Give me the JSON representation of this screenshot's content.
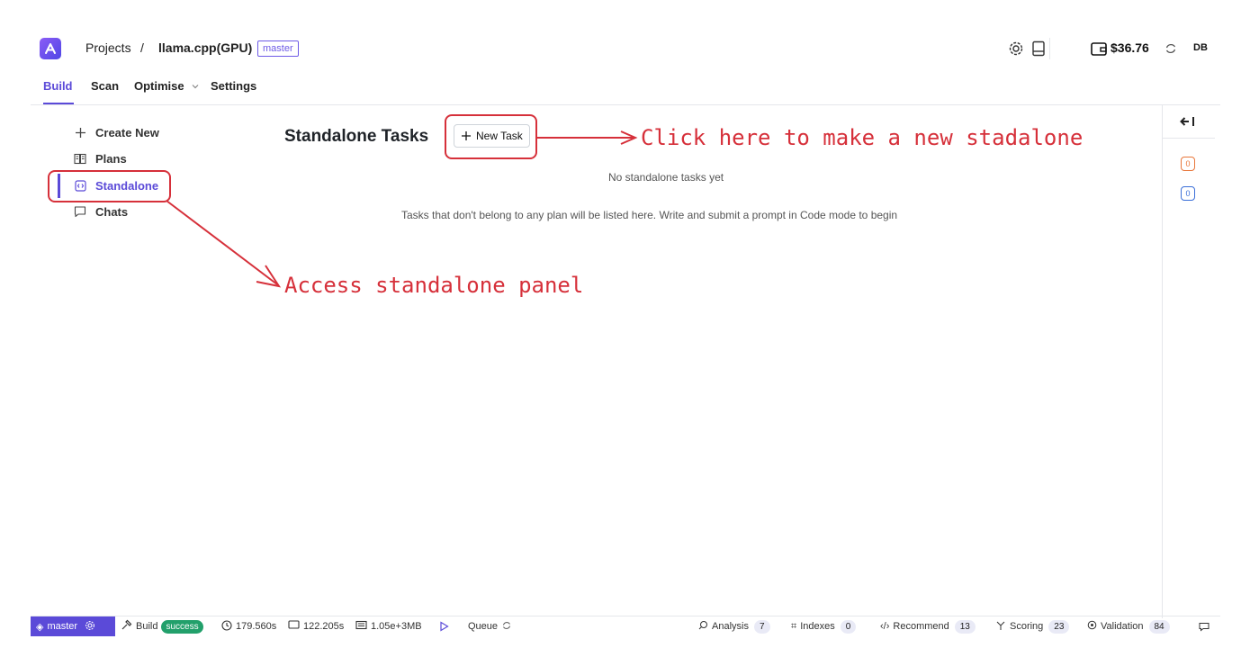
{
  "topbar": {
    "breadcrumb_root": "Projects",
    "separator": "/",
    "project": "llama.cpp(GPU)",
    "branch_tag": "master",
    "balance": "$36.76",
    "avatar": "DB"
  },
  "tabs": [
    {
      "label": "Build"
    },
    {
      "label": "Scan"
    },
    {
      "label": "Optimise"
    },
    {
      "label": "Settings"
    }
  ],
  "sidebar": {
    "items": [
      {
        "label": "Create New",
        "icon": "plus-icon"
      },
      {
        "label": "Plans",
        "icon": "book-icon"
      },
      {
        "label": "Standalone",
        "icon": "code-square-icon"
      },
      {
        "label": "Chats",
        "icon": "chat-icon"
      }
    ]
  },
  "content": {
    "title": "Standalone Tasks",
    "new_task_label": "New Task",
    "empty_title": "No standalone tasks yet",
    "empty_hint": "Tasks that don't belong to any plan will be listed here. Write and submit a prompt in Code mode to begin"
  },
  "right_panel": {
    "badge_orange": "0",
    "badge_blue": "0"
  },
  "status_bar": {
    "branch": "master",
    "build_label": "Build",
    "build_status": "success",
    "time1": "179.560s",
    "time2": "122.205s",
    "memory": "1.05e+3MB",
    "queue_label": "Queue",
    "analysis_label": "Analysis",
    "analysis_count": "7",
    "indexes_label": "Indexes",
    "indexes_count": "0",
    "recommend_label": "Recommend",
    "recommend_count": "13",
    "scoring_label": "Scoring",
    "scoring_count": "23",
    "validation_label": "Validation",
    "validation_count": "84"
  },
  "annotations": {
    "new_task": "Click here to make a new stadalone",
    "standalone": "Access standalone panel"
  },
  "colors": {
    "accent": "#5b4ad8",
    "annotation": "#d6303a",
    "success": "#22a06b"
  }
}
